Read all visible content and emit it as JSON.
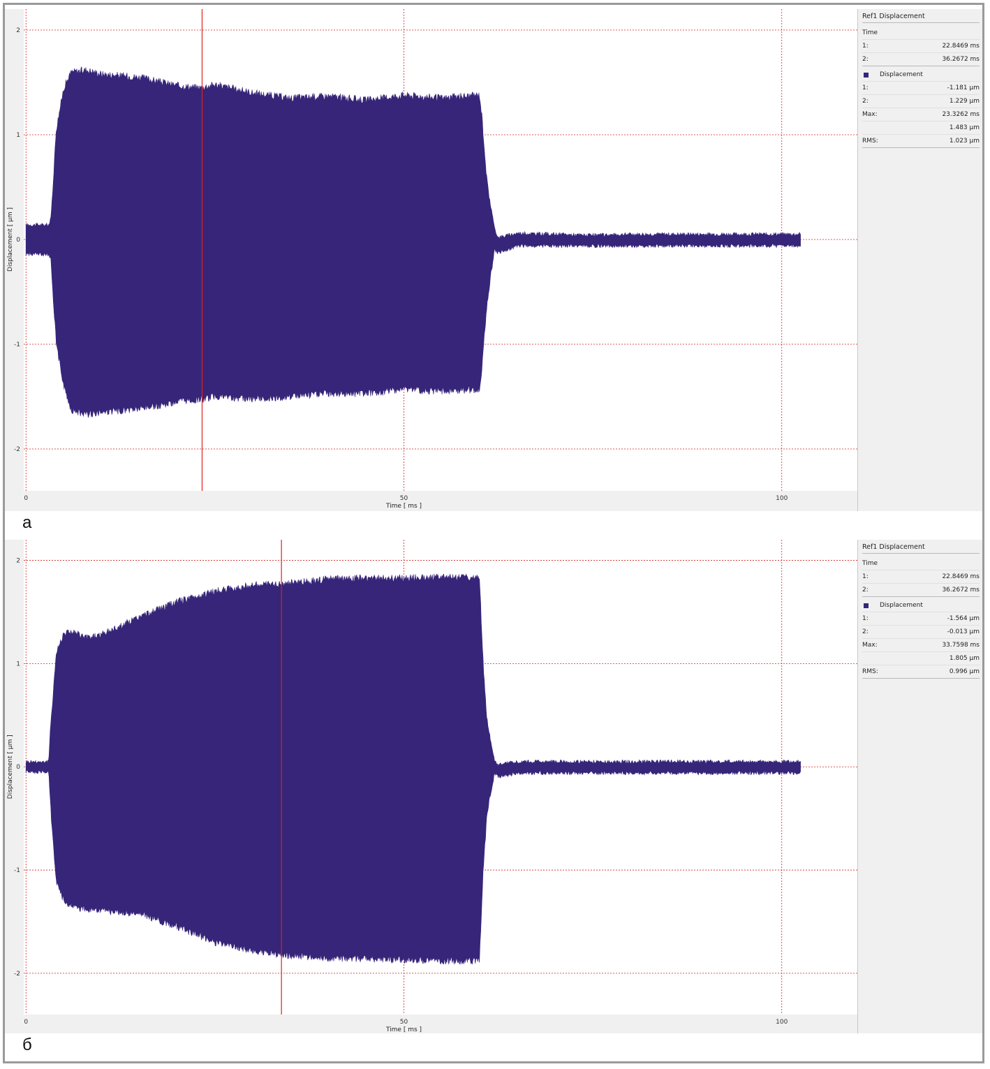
{
  "panels": [
    {
      "letter": "а",
      "info": {
        "title": "Ref1 Displacement",
        "time_header": "Time",
        "time_rows": [
          {
            "k": "1:",
            "v": "22.8469 ms"
          },
          {
            "k": "2:",
            "v": "36.2672 ms"
          }
        ],
        "series_label": "Displacement",
        "disp_rows": [
          {
            "k": "1:",
            "v": "-1.181 µm"
          },
          {
            "k": "2:",
            "v": "1.229 µm"
          },
          {
            "k": "Max:",
            "v": "23.3262 ms"
          },
          {
            "k": "",
            "v": "1.483 µm"
          },
          {
            "k": "RMS:",
            "v": "1.023 µm"
          }
        ]
      }
    },
    {
      "letter": "б",
      "info": {
        "title": "Ref1 Displacement",
        "time_header": "Time",
        "time_rows": [
          {
            "k": "1:",
            "v": "22.8469 ms"
          },
          {
            "k": "2:",
            "v": "36.2672 ms"
          }
        ],
        "series_label": "Displacement",
        "disp_rows": [
          {
            "k": "1:",
            "v": "-1.564 µm"
          },
          {
            "k": "2:",
            "v": "-0.013 µm"
          },
          {
            "k": "Max:",
            "v": "33.7598 ms"
          },
          {
            "k": "",
            "v": "1.805 µm"
          },
          {
            "k": "RMS:",
            "v": "0.996 µm"
          }
        ]
      }
    }
  ],
  "colors": {
    "signal": "#372579",
    "cursor": "#e0201a",
    "grid": "#d02020",
    "plot_bg": "#ffffff",
    "panel_bg": "#f0f0f0"
  },
  "chart_data": [
    {
      "type": "area",
      "xlabel": "Time [ ms ]",
      "ylabel": "Displacement [ µm ]",
      "xlim": [
        -0.3,
        110
      ],
      "ylim": [
        -2.4,
        2.2
      ],
      "xticks": [
        0,
        50,
        100
      ],
      "yticks": [
        -2,
        -1,
        0,
        1,
        2
      ],
      "grid": true,
      "cursor_x": 23.3,
      "series": [
        {
          "x": [
            0,
            3,
            3.3,
            4,
            5,
            6,
            8,
            10,
            15,
            20,
            23,
            25,
            30,
            35,
            40,
            45,
            50,
            55,
            60,
            60.3,
            61,
            62,
            62.5,
            65,
            70,
            75,
            80,
            85,
            90,
            95,
            100,
            102.5
          ],
          "upper": [
            0.14,
            0.14,
            0.2,
            1.05,
            1.45,
            1.6,
            1.62,
            1.58,
            1.55,
            1.47,
            1.45,
            1.48,
            1.4,
            1.35,
            1.37,
            1.33,
            1.38,
            1.35,
            1.38,
            1.2,
            0.55,
            0.1,
            0.02,
            0.06,
            0.05,
            0.04,
            0.05,
            0.05,
            0.05,
            0.05,
            0.05,
            0.05
          ],
          "lower": [
            -0.14,
            -0.14,
            -0.2,
            -1.0,
            -1.4,
            -1.63,
            -1.67,
            -1.65,
            -1.62,
            -1.55,
            -1.53,
            -1.5,
            -1.52,
            -1.5,
            -1.47,
            -1.47,
            -1.43,
            -1.45,
            -1.43,
            -1.25,
            -0.6,
            -0.1,
            -0.13,
            -0.06,
            -0.06,
            -0.06,
            -0.06,
            -0.06,
            -0.06,
            -0.06,
            -0.06,
            -0.06
          ]
        }
      ]
    },
    {
      "type": "area",
      "xlabel": "Time [ ms ]",
      "ylabel": "Displacement [ µm ]",
      "xlim": [
        -0.3,
        110
      ],
      "ylim": [
        -2.4,
        2.2
      ],
      "xticks": [
        0,
        50,
        100
      ],
      "yticks": [
        -2,
        -1,
        0,
        1,
        2
      ],
      "grid": true,
      "cursor_x": 33.8,
      "series": [
        {
          "x": [
            0,
            3,
            3.3,
            4,
            5,
            6,
            8,
            10,
            15,
            20,
            25,
            30,
            33.8,
            35,
            40,
            45,
            50,
            55,
            60,
            60.5,
            61,
            62,
            62.5,
            65,
            70,
            75,
            80,
            85,
            90,
            95,
            100,
            102.5
          ],
          "upper": [
            0.05,
            0.05,
            0.45,
            1.1,
            1.3,
            1.31,
            1.25,
            1.28,
            1.45,
            1.6,
            1.7,
            1.76,
            1.77,
            1.78,
            1.82,
            1.83,
            1.83,
            1.84,
            1.84,
            1.0,
            0.45,
            0.05,
            0.02,
            0.05,
            0.05,
            0.05,
            0.05,
            0.05,
            0.05,
            0.05,
            0.05,
            0.05
          ],
          "lower": [
            -0.05,
            -0.05,
            -0.45,
            -1.1,
            -1.3,
            -1.35,
            -1.38,
            -1.4,
            -1.42,
            -1.55,
            -1.7,
            -1.78,
            -1.82,
            -1.83,
            -1.85,
            -1.86,
            -1.87,
            -1.88,
            -1.88,
            -1.0,
            -0.45,
            -0.06,
            -0.1,
            -0.06,
            -0.06,
            -0.06,
            -0.06,
            -0.06,
            -0.06,
            -0.06,
            -0.06,
            -0.06
          ]
        }
      ]
    }
  ]
}
